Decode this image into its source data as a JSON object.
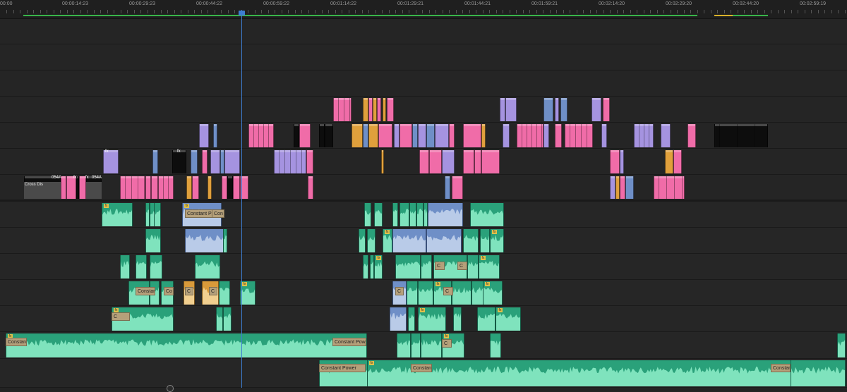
{
  "ruler": {
    "timecodes": [
      "00:00",
      "00:00:14:23",
      "00:00:29:23",
      "00:00:44:22",
      "00:00:59:22",
      "00:01:14:22",
      "00:01:29:21",
      "00:01:44:21",
      "00:01:59:21",
      "00:02:14:20",
      "00:02:29:20",
      "00:02:44:20",
      "00:02:59:19"
    ]
  },
  "colors": {
    "pink": "#f06ca8",
    "lavender": "#a593e0",
    "slate": "#6f8fc7",
    "orange": "#e0a03c",
    "black": "#0d0d0d",
    "audio_green": "#2aa17a",
    "playhead": "#3e7dd1",
    "work_area": "#39b54a",
    "work_area_alt": "#d9b22a"
  },
  "labels": {
    "cross_dissolve": "Cross Dis",
    "clip_054a": "054A",
    "fx": "fx",
    "constant_power": "Constant Power",
    "constant_power_short": "Constant Po",
    "constant_po_trunc": "Constant Po",
    "c": "C",
    "co": "Co",
    "con": "Con"
  },
  "icons": {
    "playhead": "playhead-marker-icon",
    "fx": "fx-badge-icon",
    "scroll": "zoom-scroll-handle-icon"
  }
}
